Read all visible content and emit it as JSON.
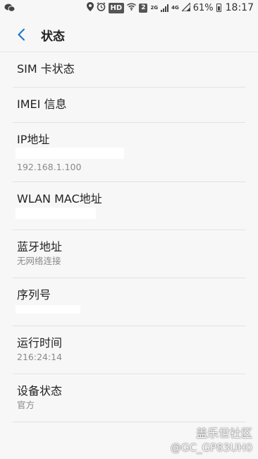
{
  "status_bar": {
    "left_icon": "wechat-icon",
    "hd": "HD",
    "sim2": "2",
    "net_2g": "2G",
    "net_4g": "4G",
    "battery_percent": "61%",
    "time": "18:17"
  },
  "header": {
    "title": "状态",
    "back_icon": "back-arrow-icon",
    "accent_color": "#1a73c6"
  },
  "items": [
    {
      "title": "SIM 卡状态",
      "subtitle": ""
    },
    {
      "title": "IMEI 信息",
      "subtitle": ""
    },
    {
      "title": "IP地址",
      "subtitle": "192.168.1.100"
    },
    {
      "title": "WLAN MAC地址",
      "subtitle": ""
    },
    {
      "title": "蓝牙地址",
      "subtitle": "无网络连接"
    },
    {
      "title": "序列号",
      "subtitle": ""
    },
    {
      "title": "运行时间",
      "subtitle": "216:24:14"
    },
    {
      "title": "设备状态",
      "subtitle": "官方"
    }
  ],
  "watermark": {
    "line1": "盖乐世社区",
    "line2": "@GC_GP83UH0"
  }
}
